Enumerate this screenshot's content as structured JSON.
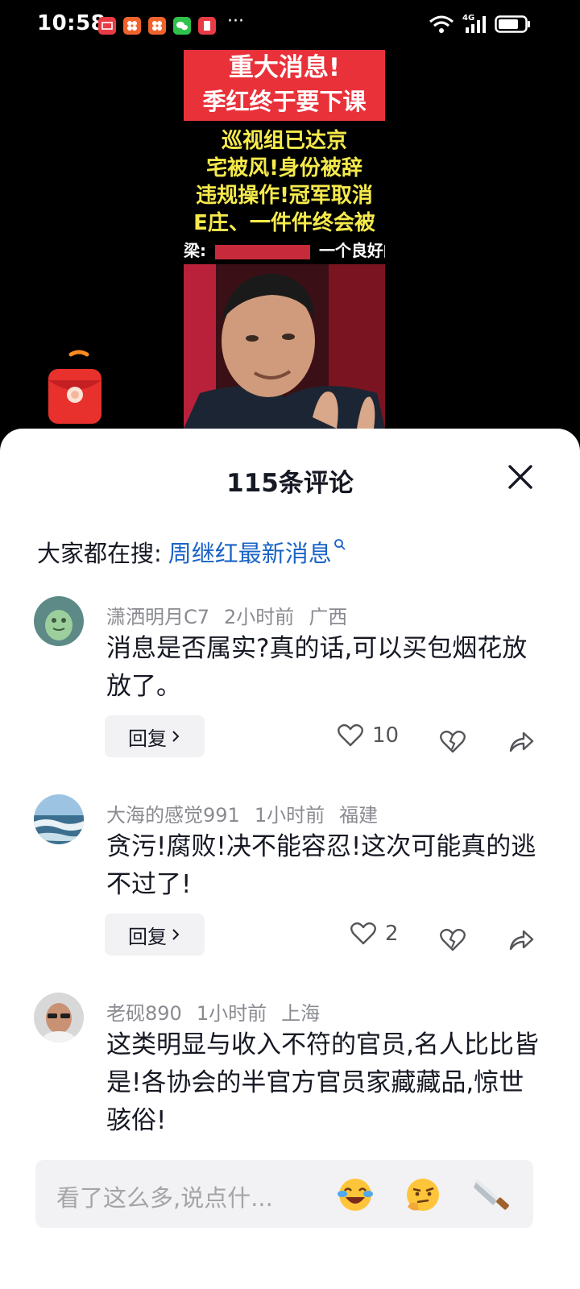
{
  "status_bar": {
    "time": "10:58",
    "more": "···",
    "network": "4G"
  },
  "video": {
    "headline_1": "重大消息!",
    "headline_2": "季红终于要下课",
    "line_1": "巡视组已达京",
    "line_2": "宅被风!身份被辞",
    "line_3": "违规操作!冠军取消",
    "line_4": "E庄、一件件终会被",
    "caption_left": "梁:",
    "caption_right": "一个良好的"
  },
  "sheet": {
    "title": "115条评论",
    "search_prefix": "大家都在搜:",
    "search_link": "周继红最新消息"
  },
  "comments": [
    {
      "user": "潇洒明月C7",
      "time": "2小时前",
      "location": "广西",
      "text": "消息是否属实?真的话,可以买包烟花放放了。",
      "reply_label": "回复",
      "likes": "10"
    },
    {
      "user": "大海的感觉991",
      "time": "1小时前",
      "location": "福建",
      "text": "贪污!腐败!决不能容忍!这次可能真的逃不过了!",
      "reply_label": "回复",
      "likes": "2"
    },
    {
      "user": "老砚890",
      "time": "1小时前",
      "location": "上海",
      "text": "这类明显与收入不符的官员,名人比比皆是!各协会的半官方官员家藏藏品,惊世骇俗!"
    }
  ],
  "input": {
    "placeholder": "看了这么多,说点什..."
  },
  "colors": {
    "link": "#1a63c6",
    "headline_bg": "#e9313a",
    "headline_text_yellow": "#f6ea4b",
    "sheet_bg": "#ffffff",
    "meta_text": "#8a8b91"
  },
  "icons": {
    "close": "close-icon",
    "search": "search-icon",
    "like": "heart-icon",
    "dislike": "broken-heart-icon",
    "share": "share-arrow-icon"
  }
}
